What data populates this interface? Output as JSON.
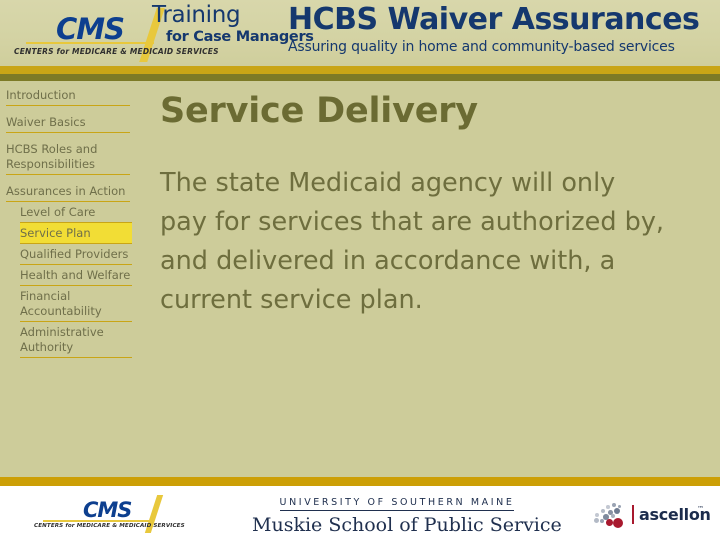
{
  "header": {
    "cms_logo": {
      "wordmark": "CMS",
      "subtext": "CENTERS for MEDICARE & MEDICAID SERVICES"
    },
    "training_line1": "Training",
    "training_line2": "for Case Managers",
    "course_title": "HCBS Waiver Assurances",
    "course_subtitle": "Assuring quality in home and community-based services"
  },
  "sidebar": {
    "items": [
      {
        "label": "Introduction",
        "level": 0,
        "active": false
      },
      {
        "label": "Waiver Basics",
        "level": 0,
        "active": false
      },
      {
        "label": "HCBS Roles and Responsibilities",
        "level": 0,
        "active": false
      },
      {
        "label": "Assurances in Action",
        "level": 0,
        "active": false
      },
      {
        "label": "Level of Care",
        "level": 1,
        "active": false
      },
      {
        "label": "Service Plan",
        "level": 1,
        "active": true
      },
      {
        "label": "Qualified Providers",
        "level": 1,
        "active": false
      },
      {
        "label": "Health and Welfare",
        "level": 1,
        "active": false
      },
      {
        "label": "Financial Accountability",
        "level": 1,
        "active": false
      },
      {
        "label": "Administrative Authority",
        "level": 1,
        "active": false
      }
    ]
  },
  "main": {
    "title": "Service Delivery",
    "body": "The state Medicaid agency will only pay for services that are authorized by, and delivered in accordance with, a current service plan."
  },
  "footer": {
    "cms_logo": {
      "wordmark": "CMS",
      "subtext": "CENTERS for MEDICARE & MEDICAID SERVICES"
    },
    "usm_line1": "UNIVERSITY OF SOUTHERN MAINE",
    "usm_line2": "Muskie School of Public Service",
    "ascellon_wordmark": "ascellon",
    "ascellon_tm": "™"
  },
  "colors": {
    "page_background": "#cdcc9a",
    "header_background": "#d4d3a4",
    "gold_bar": "#c9a516",
    "olive_bar": "#7d7a26",
    "footer_gold_bar": "#cc9f06",
    "nav_text": "#6f6f4a",
    "nav_rule": "#c9a516",
    "nav_active_background": "#f2dd35",
    "title_text": "#6b6b33",
    "body_text": "#6e6e3e",
    "logo_blue": "#0d3f8f",
    "logo_gold": "#e8c83c",
    "usm_navy": "#20304f",
    "ascellon_navy": "#1c2c4c",
    "ascellon_red": "#a8192e"
  }
}
